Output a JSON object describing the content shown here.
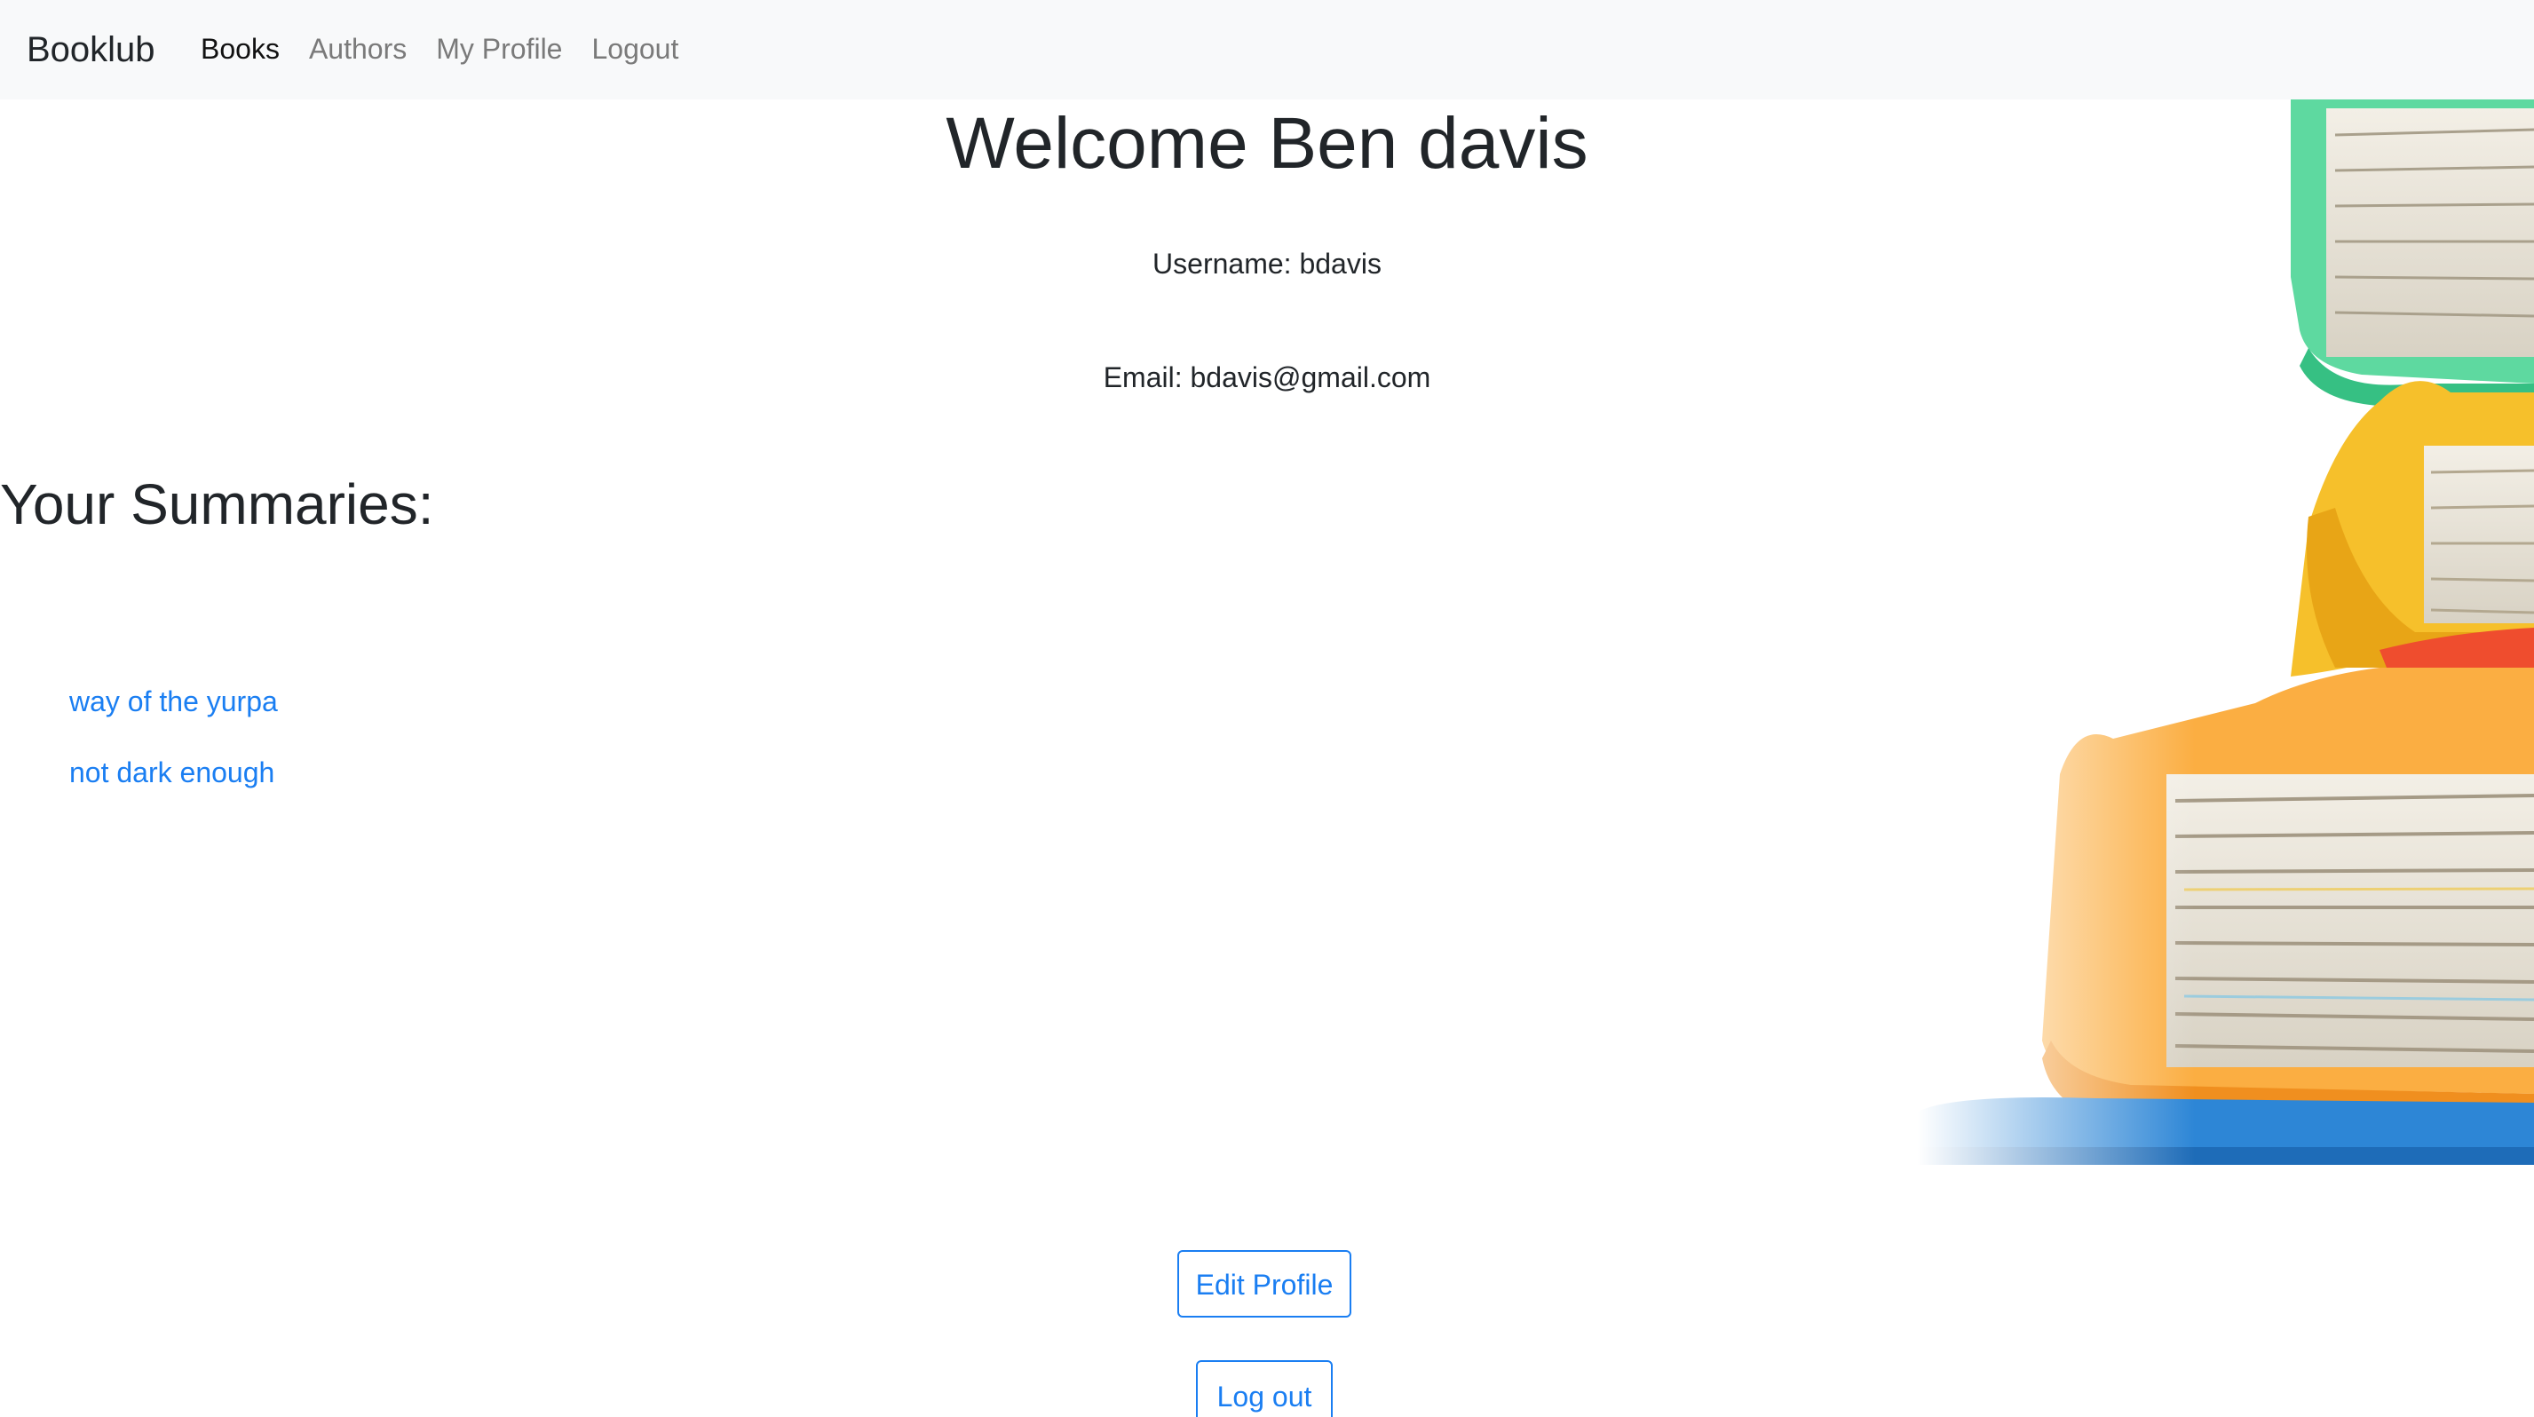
{
  "navbar": {
    "brand": "Booklub",
    "links": [
      {
        "label": "Books",
        "active": true
      },
      {
        "label": "Authors",
        "active": false
      },
      {
        "label": "My Profile",
        "active": false
      },
      {
        "label": "Logout",
        "active": false
      }
    ]
  },
  "profile": {
    "welcome": "Welcome Ben davis",
    "username_line": "Username: bdavis",
    "email_line": "Email: bdavis@gmail.com"
  },
  "summaries": {
    "heading": "Your Summaries:",
    "items": [
      {
        "title": "way of the yurpa"
      },
      {
        "title": "not dark enough"
      }
    ]
  },
  "actions": {
    "edit_profile_label": "Edit Profile",
    "logout_label": "Log out"
  },
  "colors": {
    "navbar_bg": "#f8f9fa",
    "link_blue": "#1a7ef2",
    "text": "#212529",
    "nav_muted": "#7a7a7a"
  },
  "decor": {
    "image": "stack-of-colorful-books-icon"
  }
}
